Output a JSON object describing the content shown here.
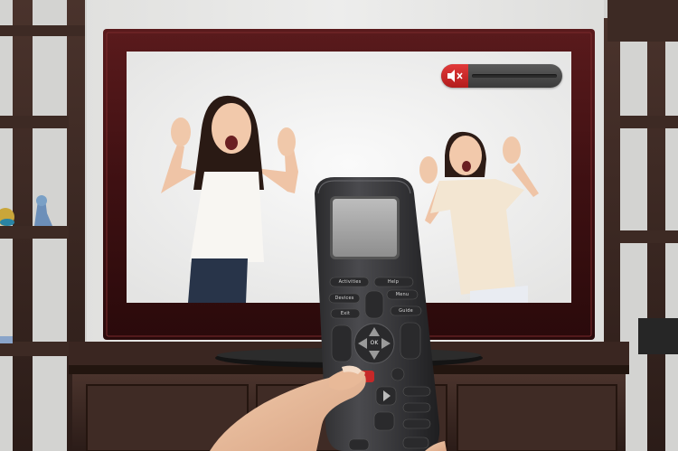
{
  "scene": {
    "subject": "hand holding universal remote pointed at a muted television showing two shouting girls",
    "colors": {
      "wall": "#e9e9e7",
      "wood": "#3a2621",
      "tv_frame": "#4a1416",
      "screen_bg": "#f1f1f0",
      "osd_red": "#d42a2a"
    }
  },
  "tv": {
    "osd": {
      "state": "muted",
      "icon": "speaker-muted-icon",
      "volume_level": 0
    }
  },
  "remote": {
    "buttons": {
      "activities": "Activities",
      "help": "Help",
      "devices": "Devices",
      "menu": "Menu",
      "exit": "Exit",
      "guide": "Guide",
      "ok": "OK"
    }
  }
}
